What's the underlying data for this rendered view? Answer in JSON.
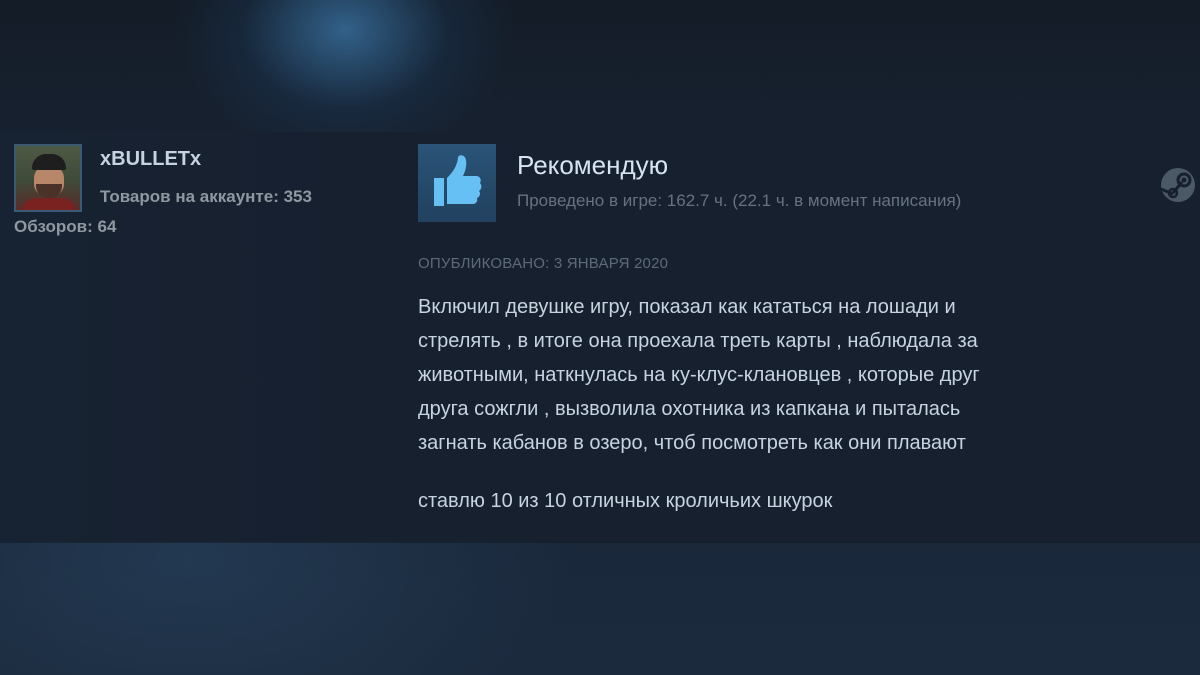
{
  "author": {
    "username": "xBULLETx",
    "products_line": "Товаров на аккаунте: 353",
    "reviews_line": "Обзоров: 64"
  },
  "review": {
    "verdict": "Рекомендую",
    "hours_line": "Проведено в игре: 162.7 ч. (22.1 ч. в момент написания)",
    "posted": "ОПУБЛИКОВАНО: 3 ЯНВАРЯ 2020",
    "body_lines": [
      "Включил девушке игру, показал как кататься на лошади и",
      "стрелять , в итоге она проехала треть карты , наблюдала за",
      "животными, наткнулась на ку-клус-клановцев , которые друг",
      "друга сожгли , вызволила охотника из капкана и пыталась",
      "загнать кабанов в озеро, чтоб посмотреть как они плавают"
    ],
    "closing": "ставлю 10 из 10 отличных кроличьих шкурок"
  },
  "icons": {
    "thumb": "thumbs-up-icon",
    "platform": "steam-icon"
  },
  "colors": {
    "background": "#1b2838",
    "text_primary": "#c6d4df",
    "text_muted": "#8f98a0",
    "thumb_bg": "#2a5478",
    "thumb_fg": "#66c0f4"
  }
}
